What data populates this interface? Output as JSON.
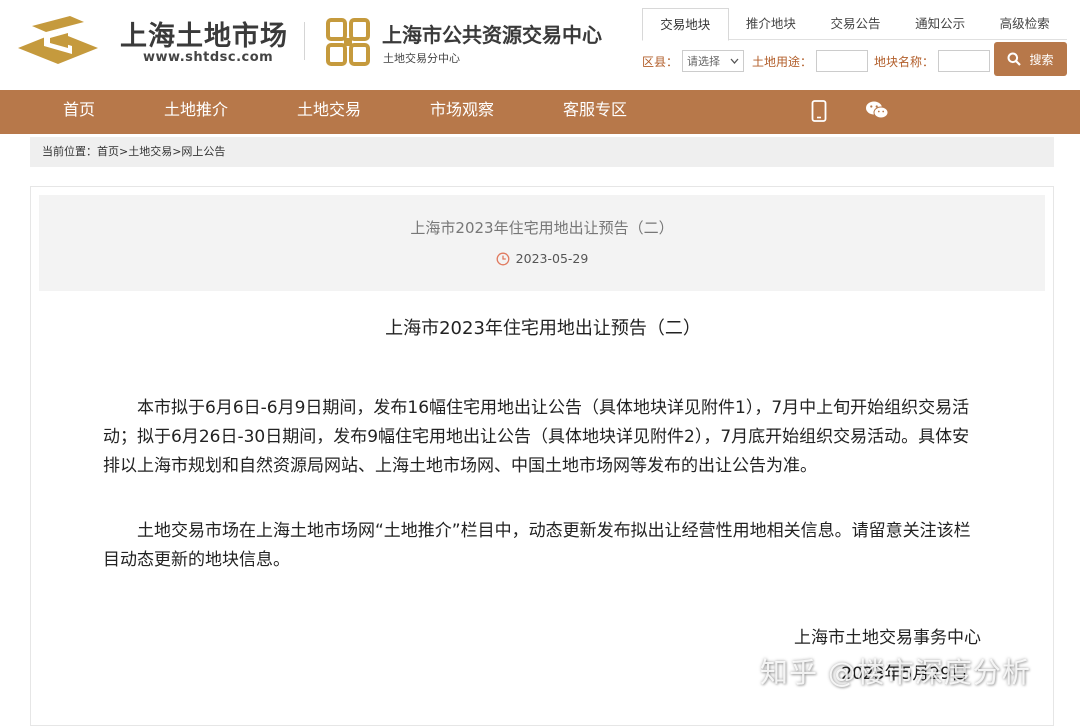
{
  "header": {
    "site_name": "上海土地市场",
    "site_url": "www.shtdsc.com",
    "center_name": "上海市公共资源交易中心",
    "center_sub": "土地交易分中心",
    "tabs": [
      "交易地块",
      "推介地块",
      "交易公告",
      "通知公示",
      "高级检索"
    ],
    "search": {
      "district_label": "区县：",
      "district_value": "请选择",
      "usage_label": "土地用途：",
      "name_label": "地块名称：",
      "button_label": "搜索"
    }
  },
  "nav": {
    "items": [
      "首页",
      "土地推介",
      "土地交易",
      "市场观察",
      "客服专区"
    ]
  },
  "breadcrumb": "当前位置：首页>土地交易>网上公告",
  "article": {
    "box_title": "上海市2023年住宅用地出让预告（二）",
    "date": "2023-05-29",
    "heading": "上海市2023年住宅用地出让预告（二）",
    "paragraphs": [
      "本市拟于6月6日-6月9日期间，发布16幅住宅用地出让公告（具体地块详见附件1），7月中上旬开始组织交易活动；拟于6月26日-30日期间，发布9幅住宅用地出让公告（具体地块详见附件2），7月底开始组织交易活动。具体安排以上海市规划和自然资源局网站、上海土地市场网、中国土地市场网等发布的出让公告为准。",
      "土地交易市场在上海土地市场网“土地推介”栏目中，动态更新发布拟出让经营性用地相关信息。请留意关注该栏目动态更新的地块信息。"
    ],
    "signature": "上海市土地交易事务中心",
    "sign_date": "2023年5月29日"
  },
  "watermark": "知乎 @楼市深度分析",
  "colors": {
    "brand": "#b7784a",
    "accent_text": "#b25e2a",
    "logo_gold": "#c59a3d"
  }
}
